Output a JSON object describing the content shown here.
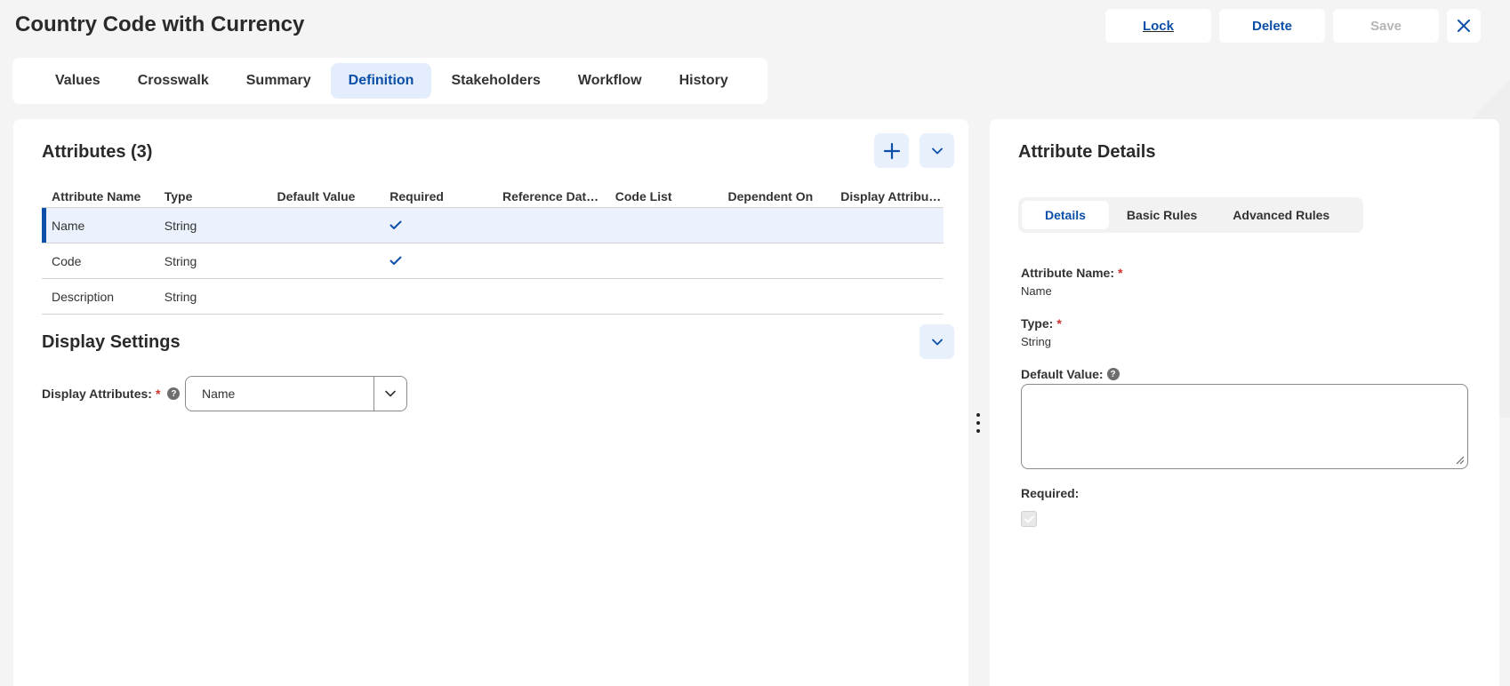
{
  "page": {
    "title": "Country Code with Currency"
  },
  "actions": {
    "lock": "Lock",
    "delete": "Delete",
    "save": "Save"
  },
  "tabs": [
    {
      "label": "Values"
    },
    {
      "label": "Crosswalk"
    },
    {
      "label": "Summary"
    },
    {
      "label": "Definition",
      "active": true
    },
    {
      "label": "Stakeholders"
    },
    {
      "label": "Workflow"
    },
    {
      "label": "History"
    }
  ],
  "attributes": {
    "title": "Attributes (3)",
    "columns": [
      "Attribute Name",
      "Type",
      "Default Value",
      "Required",
      "Reference Data ...",
      "Code List",
      "Dependent On",
      "Display Attributes"
    ],
    "rows": [
      {
        "name": "Name",
        "type": "String",
        "required": true,
        "selected": true
      },
      {
        "name": "Code",
        "type": "String",
        "required": true,
        "selected": false
      },
      {
        "name": "Description",
        "type": "String",
        "required": false,
        "selected": false
      }
    ]
  },
  "display_settings": {
    "title": "Display Settings",
    "label": "Display Attributes:",
    "required_mark": "*",
    "help": "?",
    "value": "Name"
  },
  "details": {
    "title": "Attribute Details",
    "subtabs": [
      {
        "label": "Details",
        "active": true
      },
      {
        "label": "Basic Rules"
      },
      {
        "label": "Advanced Rules"
      }
    ],
    "attr_name_label": "Attribute Name:",
    "attr_name_value": "Name",
    "type_label": "Type:",
    "type_value": "String",
    "default_label": "Default Value:",
    "default_value": "",
    "required_label": "Required:",
    "required_mark": "*",
    "help": "?"
  },
  "colors": {
    "accent": "#0b4fa8",
    "selected_row": "#ebf2fd",
    "required": "#d0312d"
  }
}
